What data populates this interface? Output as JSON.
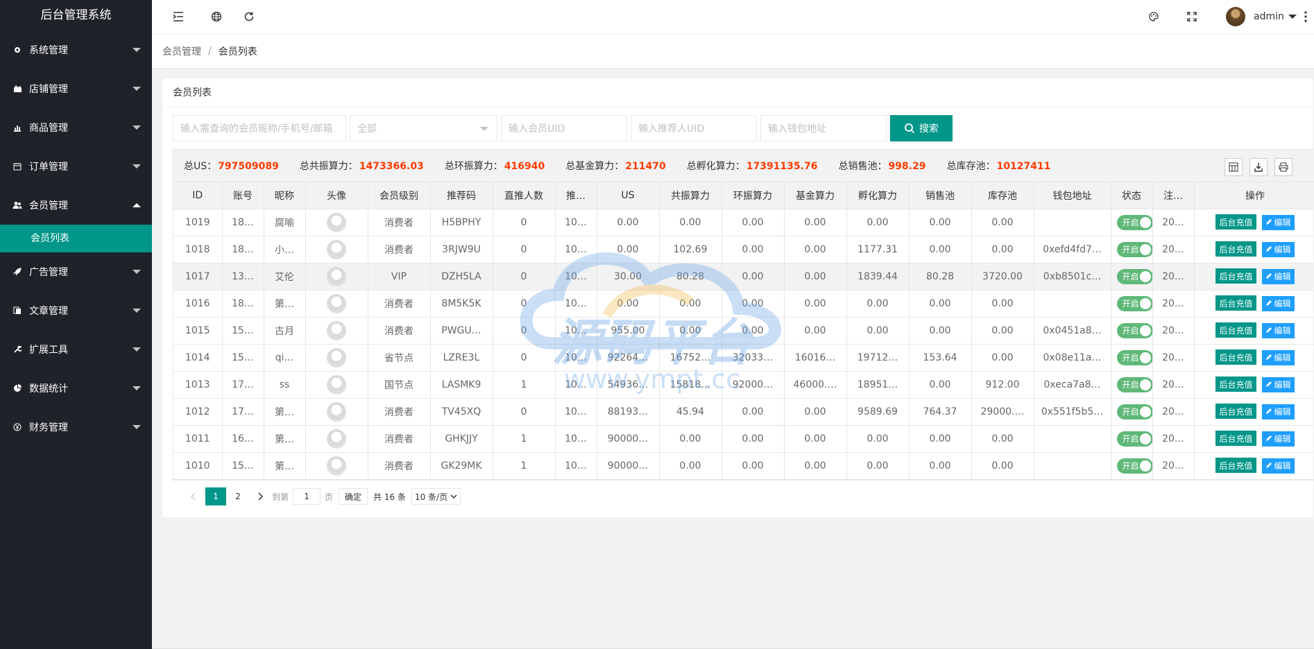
{
  "app_title": "后台管理系统",
  "sidebar": {
    "items": [
      {
        "label": "系统管理",
        "icon": "gear-icon"
      },
      {
        "label": "店铺管理",
        "icon": "shop-icon"
      },
      {
        "label": "商品管理",
        "icon": "bar-chart-icon"
      },
      {
        "label": "订单管理",
        "icon": "calendar-icon"
      },
      {
        "label": "会员管理",
        "icon": "users-icon"
      },
      {
        "label": "广告管理",
        "icon": "rocket-icon"
      },
      {
        "label": "文章管理",
        "icon": "file-icon"
      },
      {
        "label": "扩展工具",
        "icon": "wrench-icon"
      },
      {
        "label": "数据统计",
        "icon": "pie-icon"
      },
      {
        "label": "财务管理",
        "icon": "yen-icon"
      }
    ],
    "active_sub": "会员列表"
  },
  "header": {
    "user": "admin"
  },
  "breadcrumb": {
    "parent": "会员管理",
    "separator": "/",
    "current": "会员列表"
  },
  "card": {
    "title": "会员列表"
  },
  "filters": {
    "search_placeholder": "输入需查询的会员昵称/手机号/邮箱",
    "level_select": "全部",
    "uid_placeholder": "输入会员UID",
    "ref_uid_placeholder": "输入推荐人UID",
    "wallet_placeholder": "输入钱包地址",
    "search_button": "搜索"
  },
  "totals": [
    {
      "label": "总US：",
      "value": "797509089"
    },
    {
      "label": "总共振算力：",
      "value": "1473366.03"
    },
    {
      "label": "总环振算力：",
      "value": "416940"
    },
    {
      "label": "总基金算力：",
      "value": "211470"
    },
    {
      "label": "总孵化算力：",
      "value": "17391135.76"
    },
    {
      "label": "总销售池：",
      "value": "998.29"
    },
    {
      "label": "总库存池：",
      "value": "10127411"
    }
  ],
  "table": {
    "headers": [
      "ID",
      "账号",
      "昵称",
      "头像",
      "会员级别",
      "推荐码",
      "直推人数",
      "推…",
      "US",
      "共振算力",
      "环振算力",
      "基金算力",
      "孵化算力",
      "销售池",
      "库存池",
      "钱包地址",
      "状态",
      "注…",
      "操作"
    ],
    "rows": [
      [
        "1019",
        "18…",
        "腐喻",
        "",
        "消费者",
        "H5BPHY",
        "0",
        "10…",
        "0.00",
        "0.00",
        "0.00",
        "0.00",
        "0.00",
        "0.00",
        "0.00",
        "",
        "开启",
        "20…"
      ],
      [
        "1018",
        "18…",
        "小…",
        "",
        "消费者",
        "3RJW9U",
        "0",
        "10…",
        "0.00",
        "102.69",
        "0.00",
        "0.00",
        "1177.31",
        "0.00",
        "0.00",
        "0xefd4fd7…",
        "开启",
        "20…"
      ],
      [
        "1017",
        "13…",
        "艾伦",
        "",
        "VIP",
        "DZH5LA",
        "0",
        "10…",
        "30.00",
        "80.28",
        "0.00",
        "0.00",
        "1839.44",
        "80.28",
        "3720.00",
        "0xb8501c…",
        "开启",
        "20…"
      ],
      [
        "1016",
        "18…",
        "第…",
        "",
        "消费者",
        "8M5K5K",
        "0",
        "10…",
        "0.00",
        "0.00",
        "0.00",
        "0.00",
        "0.00",
        "0.00",
        "0.00",
        "",
        "开启",
        "20…"
      ],
      [
        "1015",
        "15…",
        "古月",
        "",
        "消费者",
        "PWGU…",
        "0",
        "10…",
        "955.00",
        "0.00",
        "0.00",
        "0.00",
        "0.00",
        "0.00",
        "0.00",
        "0x0451a8…",
        "开启",
        "20…"
      ],
      [
        "1014",
        "15…",
        "qi…",
        "",
        "省节点",
        "LZRE3L",
        "0",
        "10…",
        "92264…",
        "16752…",
        "32033…",
        "16016…",
        "19712…",
        "153.64",
        "0.00",
        "0x08e11a…",
        "开启",
        "20…"
      ],
      [
        "1013",
        "17…",
        "ss",
        "",
        "国节点",
        "LASMK9",
        "1",
        "10…",
        "54936…",
        "15818…",
        "92000…",
        "46000.…",
        "18951…",
        "0.00",
        "912.00",
        "0xeca7a8…",
        "开启",
        "20…"
      ],
      [
        "1012",
        "17…",
        "第…",
        "",
        "消费者",
        "TV45XQ",
        "0",
        "10…",
        "88193…",
        "45.94",
        "0.00",
        "0.00",
        "9589.69",
        "764.37",
        "29000.…",
        "0x551f5b5…",
        "开启",
        "20…"
      ],
      [
        "1011",
        "16…",
        "第…",
        "",
        "消费者",
        "GHKJJY",
        "1",
        "10…",
        "90000…",
        "0.00",
        "0.00",
        "0.00",
        "0.00",
        "0.00",
        "0.00",
        "",
        "开启",
        "20…"
      ],
      [
        "1010",
        "15…",
        "第…",
        "",
        "消费者",
        "GK29MK",
        "1",
        "10…",
        "90000…",
        "0.00",
        "0.00",
        "0.00",
        "0.00",
        "0.00",
        "0.00",
        "",
        "开启",
        "20…"
      ]
    ],
    "recharge_label": "后台充值",
    "edit_label": "编辑"
  },
  "pager": {
    "pages": [
      "1",
      "2"
    ],
    "goto_label": "到第",
    "goto_value": "1",
    "page_label": "页",
    "confirm": "确定",
    "total": "共 16 条",
    "per_page": "10 条/页"
  },
  "watermark": {
    "text": "源码平台",
    "url": "www.ympt.cc"
  }
}
